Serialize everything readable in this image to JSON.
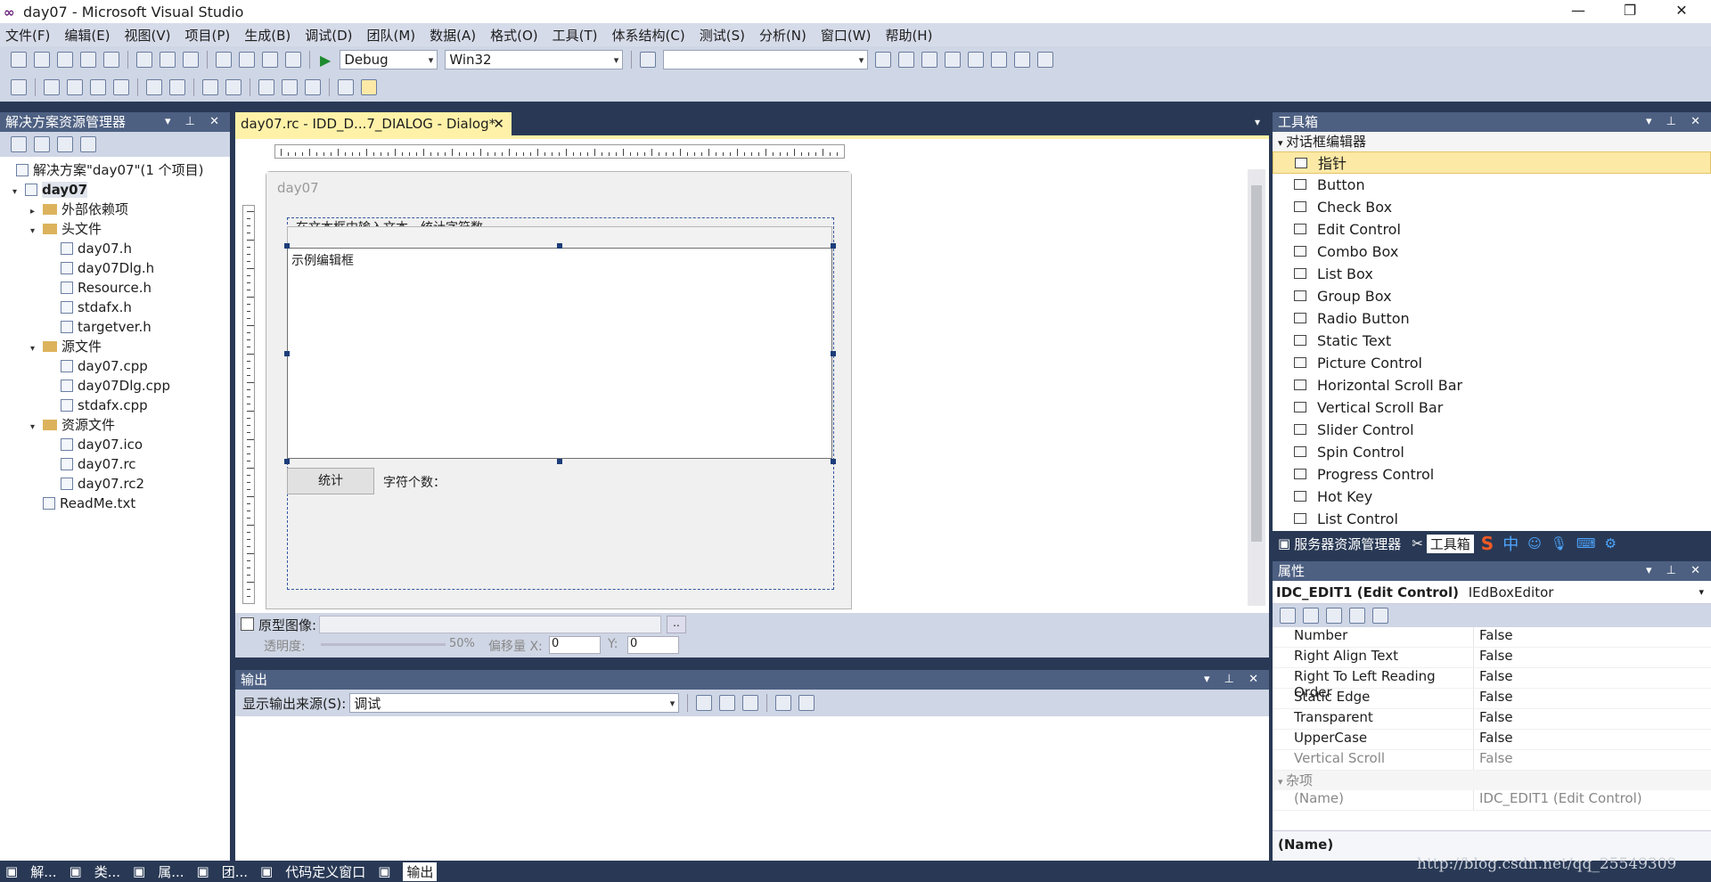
{
  "window": {
    "title": "day07 - Microsoft Visual Studio"
  },
  "menu": [
    "文件(F)",
    "编辑(E)",
    "视图(V)",
    "项目(P)",
    "生成(B)",
    "调试(D)",
    "团队(M)",
    "数据(A)",
    "格式(O)",
    "工具(T)",
    "体系结构(C)",
    "测试(S)",
    "分析(N)",
    "窗口(W)",
    "帮助(H)"
  ],
  "toolbar": {
    "config": "Debug",
    "platform": "Win32",
    "find_placeholder": ""
  },
  "solution": {
    "title": "解决方案资源管理器",
    "root": "解决方案\"day07\"(1 个项目)",
    "project": "day07",
    "items": [
      {
        "label": "外部依赖项",
        "level": 2,
        "type": "folder"
      },
      {
        "label": "头文件",
        "level": 2,
        "type": "folder"
      },
      {
        "label": "day07.h",
        "level": 3,
        "type": "file"
      },
      {
        "label": "day07Dlg.h",
        "level": 3,
        "type": "file"
      },
      {
        "label": "Resource.h",
        "level": 3,
        "type": "file"
      },
      {
        "label": "stdafx.h",
        "level": 3,
        "type": "file"
      },
      {
        "label": "targetver.h",
        "level": 3,
        "type": "file"
      },
      {
        "label": "源文件",
        "level": 2,
        "type": "folder"
      },
      {
        "label": "day07.cpp",
        "level": 3,
        "type": "file"
      },
      {
        "label": "day07Dlg.cpp",
        "level": 3,
        "type": "file"
      },
      {
        "label": "stdafx.cpp",
        "level": 3,
        "type": "file"
      },
      {
        "label": "资源文件",
        "level": 2,
        "type": "folder"
      },
      {
        "label": "day07.ico",
        "level": 3,
        "type": "file"
      },
      {
        "label": "day07.rc",
        "level": 3,
        "type": "file"
      },
      {
        "label": "day07.rc2",
        "level": 3,
        "type": "file"
      },
      {
        "label": "ReadMe.txt",
        "level": 2,
        "type": "file"
      }
    ]
  },
  "doc": {
    "tab": "day07.rc - IDD_D...7_DIALOG - Dialog*",
    "dialog_caption": "day07",
    "static_text": "在文本框中输入文本，统计字符数",
    "edit_text": "示例编辑框",
    "button": "统计",
    "count_label": "字符个数：",
    "proto_label": "原型图像:",
    "opacity_label": "透明度:",
    "opacity_value": "50%",
    "offset_label": "偏移量 X:",
    "x_value": "0",
    "y_label": "Y:",
    "y_value": "0"
  },
  "output": {
    "title": "输出",
    "source_label": "显示输出来源(S):",
    "source_value": "调试"
  },
  "toolbox": {
    "title": "工具箱",
    "section": "对话框编辑器",
    "items": [
      "指针",
      "Button",
      "Check Box",
      "Edit Control",
      "Combo Box",
      "List Box",
      "Group Box",
      "Radio Button",
      "Static Text",
      "Picture Control",
      "Horizontal Scroll Bar",
      "Vertical Scroll Bar",
      "Slider Control",
      "Spin Control",
      "Progress Control",
      "Hot Key",
      "List Control"
    ],
    "tabs": [
      "服务器资源管理器",
      "工具箱"
    ],
    "ime": "中"
  },
  "properties": {
    "title": "属性",
    "object": "IDC_EDIT1 (Edit Control)",
    "editor": "IEdBoxEditor",
    "rows": [
      {
        "k": "Number",
        "v": "False"
      },
      {
        "k": "Right Align Text",
        "v": "False"
      },
      {
        "k": "Right To Left Reading Order",
        "v": "False"
      },
      {
        "k": "Static Edge",
        "v": "False"
      },
      {
        "k": "Transparent",
        "v": "False"
      },
      {
        "k": "UpperCase",
        "v": "False"
      },
      {
        "k": "Vertical Scroll",
        "v": "False"
      }
    ],
    "misc_section": "杂项",
    "name_row": {
      "k": "(Name)",
      "v": "IDC_EDIT1 (Edit Control)"
    },
    "footer": "(Name)"
  },
  "taskbar": [
    "解...",
    "类...",
    "属...",
    "团...",
    "代码定义窗口",
    "输出"
  ],
  "watermark": "http://blog.csdn.net/qq_25549309"
}
